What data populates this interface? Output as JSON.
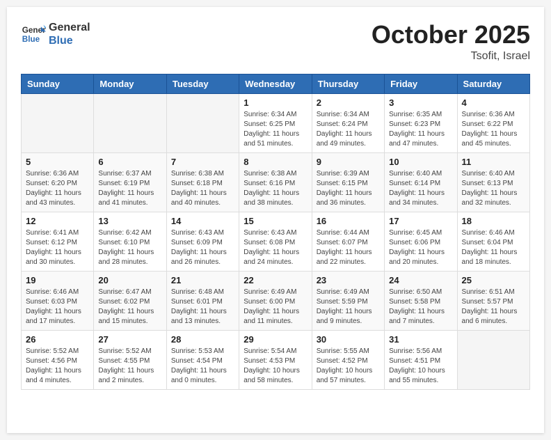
{
  "header": {
    "logo_general": "General",
    "logo_blue": "Blue",
    "month": "October 2025",
    "location": "Tsofit, Israel"
  },
  "weekdays": [
    "Sunday",
    "Monday",
    "Tuesday",
    "Wednesday",
    "Thursday",
    "Friday",
    "Saturday"
  ],
  "weeks": [
    [
      {
        "day": "",
        "info": ""
      },
      {
        "day": "",
        "info": ""
      },
      {
        "day": "",
        "info": ""
      },
      {
        "day": "1",
        "info": "Sunrise: 6:34 AM\nSunset: 6:25 PM\nDaylight: 11 hours\nand 51 minutes."
      },
      {
        "day": "2",
        "info": "Sunrise: 6:34 AM\nSunset: 6:24 PM\nDaylight: 11 hours\nand 49 minutes."
      },
      {
        "day": "3",
        "info": "Sunrise: 6:35 AM\nSunset: 6:23 PM\nDaylight: 11 hours\nand 47 minutes."
      },
      {
        "day": "4",
        "info": "Sunrise: 6:36 AM\nSunset: 6:22 PM\nDaylight: 11 hours\nand 45 minutes."
      }
    ],
    [
      {
        "day": "5",
        "info": "Sunrise: 6:36 AM\nSunset: 6:20 PM\nDaylight: 11 hours\nand 43 minutes."
      },
      {
        "day": "6",
        "info": "Sunrise: 6:37 AM\nSunset: 6:19 PM\nDaylight: 11 hours\nand 41 minutes."
      },
      {
        "day": "7",
        "info": "Sunrise: 6:38 AM\nSunset: 6:18 PM\nDaylight: 11 hours\nand 40 minutes."
      },
      {
        "day": "8",
        "info": "Sunrise: 6:38 AM\nSunset: 6:16 PM\nDaylight: 11 hours\nand 38 minutes."
      },
      {
        "day": "9",
        "info": "Sunrise: 6:39 AM\nSunset: 6:15 PM\nDaylight: 11 hours\nand 36 minutes."
      },
      {
        "day": "10",
        "info": "Sunrise: 6:40 AM\nSunset: 6:14 PM\nDaylight: 11 hours\nand 34 minutes."
      },
      {
        "day": "11",
        "info": "Sunrise: 6:40 AM\nSunset: 6:13 PM\nDaylight: 11 hours\nand 32 minutes."
      }
    ],
    [
      {
        "day": "12",
        "info": "Sunrise: 6:41 AM\nSunset: 6:12 PM\nDaylight: 11 hours\nand 30 minutes."
      },
      {
        "day": "13",
        "info": "Sunrise: 6:42 AM\nSunset: 6:10 PM\nDaylight: 11 hours\nand 28 minutes."
      },
      {
        "day": "14",
        "info": "Sunrise: 6:43 AM\nSunset: 6:09 PM\nDaylight: 11 hours\nand 26 minutes."
      },
      {
        "day": "15",
        "info": "Sunrise: 6:43 AM\nSunset: 6:08 PM\nDaylight: 11 hours\nand 24 minutes."
      },
      {
        "day": "16",
        "info": "Sunrise: 6:44 AM\nSunset: 6:07 PM\nDaylight: 11 hours\nand 22 minutes."
      },
      {
        "day": "17",
        "info": "Sunrise: 6:45 AM\nSunset: 6:06 PM\nDaylight: 11 hours\nand 20 minutes."
      },
      {
        "day": "18",
        "info": "Sunrise: 6:46 AM\nSunset: 6:04 PM\nDaylight: 11 hours\nand 18 minutes."
      }
    ],
    [
      {
        "day": "19",
        "info": "Sunrise: 6:46 AM\nSunset: 6:03 PM\nDaylight: 11 hours\nand 17 minutes."
      },
      {
        "day": "20",
        "info": "Sunrise: 6:47 AM\nSunset: 6:02 PM\nDaylight: 11 hours\nand 15 minutes."
      },
      {
        "day": "21",
        "info": "Sunrise: 6:48 AM\nSunset: 6:01 PM\nDaylight: 11 hours\nand 13 minutes."
      },
      {
        "day": "22",
        "info": "Sunrise: 6:49 AM\nSunset: 6:00 PM\nDaylight: 11 hours\nand 11 minutes."
      },
      {
        "day": "23",
        "info": "Sunrise: 6:49 AM\nSunset: 5:59 PM\nDaylight: 11 hours\nand 9 minutes."
      },
      {
        "day": "24",
        "info": "Sunrise: 6:50 AM\nSunset: 5:58 PM\nDaylight: 11 hours\nand 7 minutes."
      },
      {
        "day": "25",
        "info": "Sunrise: 6:51 AM\nSunset: 5:57 PM\nDaylight: 11 hours\nand 6 minutes."
      }
    ],
    [
      {
        "day": "26",
        "info": "Sunrise: 5:52 AM\nSunset: 4:56 PM\nDaylight: 11 hours\nand 4 minutes."
      },
      {
        "day": "27",
        "info": "Sunrise: 5:52 AM\nSunset: 4:55 PM\nDaylight: 11 hours\nand 2 minutes."
      },
      {
        "day": "28",
        "info": "Sunrise: 5:53 AM\nSunset: 4:54 PM\nDaylight: 11 hours\nand 0 minutes."
      },
      {
        "day": "29",
        "info": "Sunrise: 5:54 AM\nSunset: 4:53 PM\nDaylight: 10 hours\nand 58 minutes."
      },
      {
        "day": "30",
        "info": "Sunrise: 5:55 AM\nSunset: 4:52 PM\nDaylight: 10 hours\nand 57 minutes."
      },
      {
        "day": "31",
        "info": "Sunrise: 5:56 AM\nSunset: 4:51 PM\nDaylight: 10 hours\nand 55 minutes."
      },
      {
        "day": "",
        "info": ""
      }
    ]
  ]
}
